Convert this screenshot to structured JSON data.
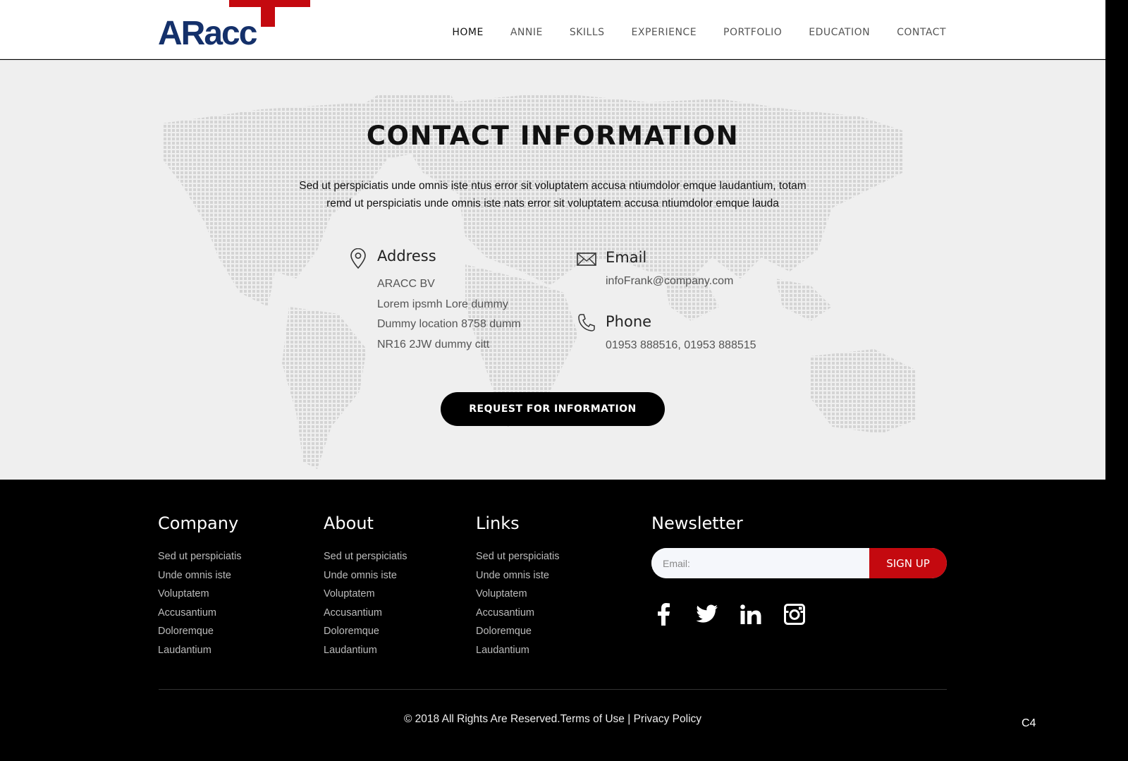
{
  "header": {
    "logo_text": "ARacc",
    "nav": [
      {
        "label": "HOME",
        "active": true
      },
      {
        "label": "ANNIE"
      },
      {
        "label": "SKILLS"
      },
      {
        "label": "EXPERIENCE"
      },
      {
        "label": "PORTFOLIO"
      },
      {
        "label": "EDUCATION"
      },
      {
        "label": "CONTACT"
      }
    ]
  },
  "contact": {
    "title": "CONTACT INFORMATION",
    "description": "Sed ut perspiciatis unde omnis iste ntus error sit voluptatem accusa ntiumdolor emque laudantium, totam remd ut perspiciatis unde omnis iste nats error sit voluptatem accusa ntiumdolor emque lauda",
    "address": {
      "title": "Address",
      "icon": "map-pin-icon",
      "lines": [
        "ARACC BV",
        "Lorem ipsmh Lore dummy",
        "Dummy location 8758 dumm",
        "NR16 2JW dummy citt"
      ]
    },
    "email": {
      "title": "Email",
      "icon": "envelope-icon",
      "value": "infoFrank@company.com"
    },
    "phone": {
      "title": "Phone",
      "icon": "phone-icon",
      "value": "01953 888516, 01953 888515"
    },
    "button_label": "REQUEST FOR INFORMATION"
  },
  "footer": {
    "columns": [
      {
        "title": "Company",
        "links": [
          "Sed ut perspiciatis",
          "Unde omnis iste",
          "Voluptatem",
          "Accusantium",
          "Doloremque",
          "Laudantium"
        ]
      },
      {
        "title": "About",
        "links": [
          "Sed ut perspiciatis",
          "Unde omnis iste",
          "Voluptatem",
          "Accusantium",
          "Doloremque",
          "Laudantium"
        ]
      },
      {
        "title": "Links",
        "links": [
          "Sed ut perspiciatis",
          "Unde omnis iste",
          "Voluptatem",
          "Accusantium",
          "Doloremque",
          "Laudantium"
        ]
      }
    ],
    "newsletter": {
      "title": "Newsletter",
      "placeholder": "Email:",
      "button_label": "SIGN UP"
    },
    "social": [
      "facebook-icon",
      "twitter-icon",
      "linkedin-icon",
      "instagram-icon"
    ],
    "copyright": "© 2018 All Rights Are Reserved.",
    "terms": "Terms of Use",
    "separator": " | ",
    "privacy": "Privacy Policy",
    "corner_code": "C4"
  },
  "colors": {
    "brand_blue": "#14306a",
    "brand_red": "#c4090f",
    "section_bg": "#efefef"
  }
}
